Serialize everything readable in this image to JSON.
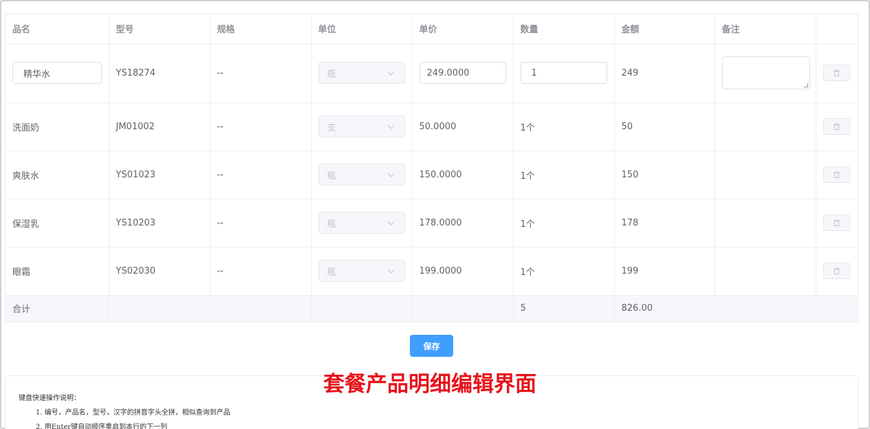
{
  "table": {
    "headers": [
      "品名",
      "型号",
      "规格",
      "单位",
      "单价",
      "数量",
      "金额",
      "备注",
      ""
    ],
    "first_row": {
      "name_value": "精华水",
      "model": "YS18274",
      "spec": "--",
      "unit": "瓶",
      "price_value": "249.0000",
      "qty_value": "1",
      "amount": "249",
      "remark_value": ""
    },
    "rows": [
      {
        "name": "洗面奶",
        "model": "JM01002",
        "spec": "--",
        "unit": "支",
        "price": "50.0000",
        "qty": "1个",
        "amount": "50"
      },
      {
        "name": "爽肤水",
        "model": "YS01023",
        "spec": "--",
        "unit": "瓶",
        "price": "150.0000",
        "qty": "1个",
        "amount": "150"
      },
      {
        "name": "保湿乳",
        "model": "YS10203",
        "spec": "--",
        "unit": "瓶",
        "price": "178.0000",
        "qty": "1个",
        "amount": "178"
      },
      {
        "name": "眼霜",
        "model": "YS02030",
        "spec": "--",
        "unit": "瓶",
        "price": "199.0000",
        "qty": "1个",
        "amount": "199"
      }
    ],
    "summary": {
      "label": "合计",
      "qty_total": "5",
      "amount_total": "826.00"
    }
  },
  "save_label": "保存",
  "caption": "套餐产品明细编辑界面",
  "help": {
    "title": "键盘快速操作说明：",
    "items": [
      "1. 编号，产品名，型号，汉字的拼音字头全拼，相似查询到产品",
      "2. 用Enter键自动顺序重启到本行的下一列"
    ]
  },
  "colors": {
    "primary": "#409eff",
    "caption": "#e8121b"
  },
  "icons": {
    "delete": "trash-icon",
    "select": "chevron-down-icon"
  }
}
